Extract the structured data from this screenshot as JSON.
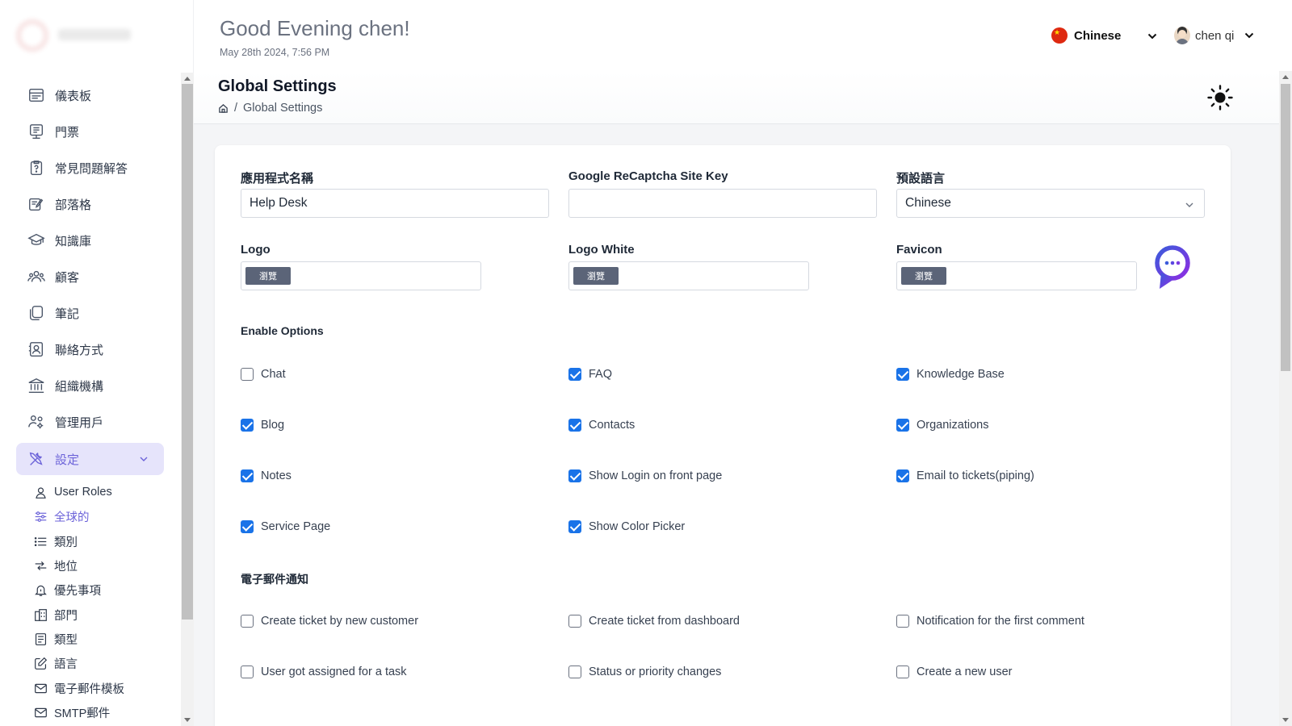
{
  "sidebar": {
    "items": [
      {
        "label": "儀表板",
        "icon": "dashboard-icon"
      },
      {
        "label": "門票",
        "icon": "ticket-icon"
      },
      {
        "label": "常見問題解答",
        "icon": "faq-icon"
      },
      {
        "label": "部落格",
        "icon": "blog-icon"
      },
      {
        "label": "知識庫",
        "icon": "knowledge-base-icon"
      },
      {
        "label": "顧客",
        "icon": "customers-icon"
      },
      {
        "label": "筆記",
        "icon": "notes-icon"
      },
      {
        "label": "聯絡方式",
        "icon": "contacts-icon"
      },
      {
        "label": "組織機構",
        "icon": "organization-icon"
      },
      {
        "label": "管理用戶",
        "icon": "manage-users-icon"
      },
      {
        "label": "設定",
        "icon": "settings-tools-icon"
      }
    ],
    "sub_items": [
      {
        "label": "User Roles",
        "icon": "user-icon"
      },
      {
        "label": "全球的",
        "icon": "sliders-icon"
      },
      {
        "label": "類別",
        "icon": "list-icon"
      },
      {
        "label": "地位",
        "icon": "status-icon"
      },
      {
        "label": "優先事項",
        "icon": "bell-icon"
      },
      {
        "label": "部門",
        "icon": "building-icon"
      },
      {
        "label": "類型",
        "icon": "type-icon"
      },
      {
        "label": "語言",
        "icon": "edit-icon"
      },
      {
        "label": "電子郵件模板",
        "icon": "mail-icon"
      },
      {
        "label": "SMTP郵件",
        "icon": "smtp-icon"
      }
    ]
  },
  "header": {
    "greeting": "Good Evening chen!",
    "datetime": "May 28th 2024, 7:56 PM",
    "language": "Chinese",
    "user_name": "chen qi"
  },
  "page": {
    "title": "Global Settings",
    "breadcrumb_current": "Global Settings"
  },
  "form": {
    "app_name_label": "應用程式名稱",
    "app_name_value": "Help Desk",
    "recaptcha_label": "Google ReCaptcha Site Key",
    "recaptcha_value": "",
    "default_language_label": "預設語言",
    "default_language_value": "Chinese",
    "logo_label": "Logo",
    "logo_white_label": "Logo White",
    "favicon_label": "Favicon",
    "browse_label": "瀏覽"
  },
  "enable_options": {
    "title": "Enable Options",
    "options": [
      {
        "label": "Chat",
        "checked": false
      },
      {
        "label": "FAQ",
        "checked": true
      },
      {
        "label": "Knowledge Base",
        "checked": true
      },
      {
        "label": "Blog",
        "checked": true
      },
      {
        "label": "Contacts",
        "checked": true
      },
      {
        "label": "Organizations",
        "checked": true
      },
      {
        "label": "Notes",
        "checked": true
      },
      {
        "label": "Show Login on front page",
        "checked": true
      },
      {
        "label": "Email to tickets(piping)",
        "checked": true
      },
      {
        "label": "Service Page",
        "checked": true
      },
      {
        "label": "Show Color Picker",
        "checked": true
      }
    ]
  },
  "email_notifications": {
    "title": "電子郵件通知",
    "options": [
      {
        "label": "Create ticket by new customer",
        "checked": false
      },
      {
        "label": "Create ticket from dashboard",
        "checked": false
      },
      {
        "label": "Notification for the first comment",
        "checked": false
      },
      {
        "label": "User got assigned for a task",
        "checked": false
      },
      {
        "label": "Status or priority changes",
        "checked": false
      },
      {
        "label": "Create a new user",
        "checked": false
      }
    ]
  },
  "colors": {
    "accent": "#6c63d9",
    "accent_bg": "#e6e4fb",
    "checkbox": "#1a73e8"
  }
}
